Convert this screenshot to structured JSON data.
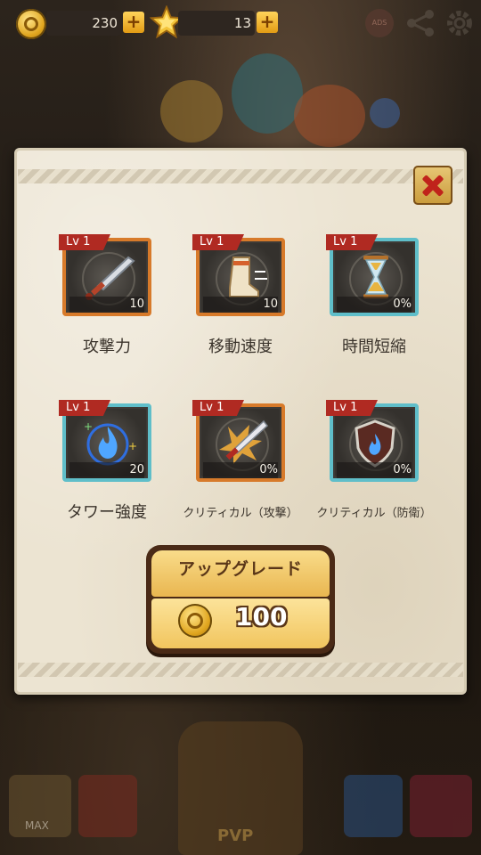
{
  "topbar": {
    "coins": "230",
    "stars": "13",
    "ads_label": "ADS"
  },
  "skills": [
    {
      "level": "Lv 1",
      "value": "10",
      "name": "攻撃力",
      "icon": "sword-icon",
      "frame": "orange"
    },
    {
      "level": "Lv 1",
      "value": "10",
      "name": "移動速度",
      "icon": "boot-icon",
      "frame": "orange"
    },
    {
      "level": "Lv 1",
      "value": "0%",
      "name": "時間短縮",
      "icon": "hourglass-icon",
      "frame": "blue"
    },
    {
      "level": "Lv 1",
      "value": "20",
      "name": "タワー強度",
      "icon": "blue-flame-icon",
      "frame": "blue"
    },
    {
      "level": "Lv 1",
      "value": "0%",
      "name": "クリティカル（攻撃）",
      "icon": "critical-sword-icon",
      "frame": "orange"
    },
    {
      "level": "Lv 1",
      "value": "0%",
      "name": "クリティカル（防衛）",
      "icon": "shield-flame-icon",
      "frame": "blue"
    }
  ],
  "upgrade": {
    "label": "アップグレード",
    "cost": "100"
  },
  "bottomnav": {
    "max_label": "MAX",
    "pvp_label": "PVP"
  }
}
